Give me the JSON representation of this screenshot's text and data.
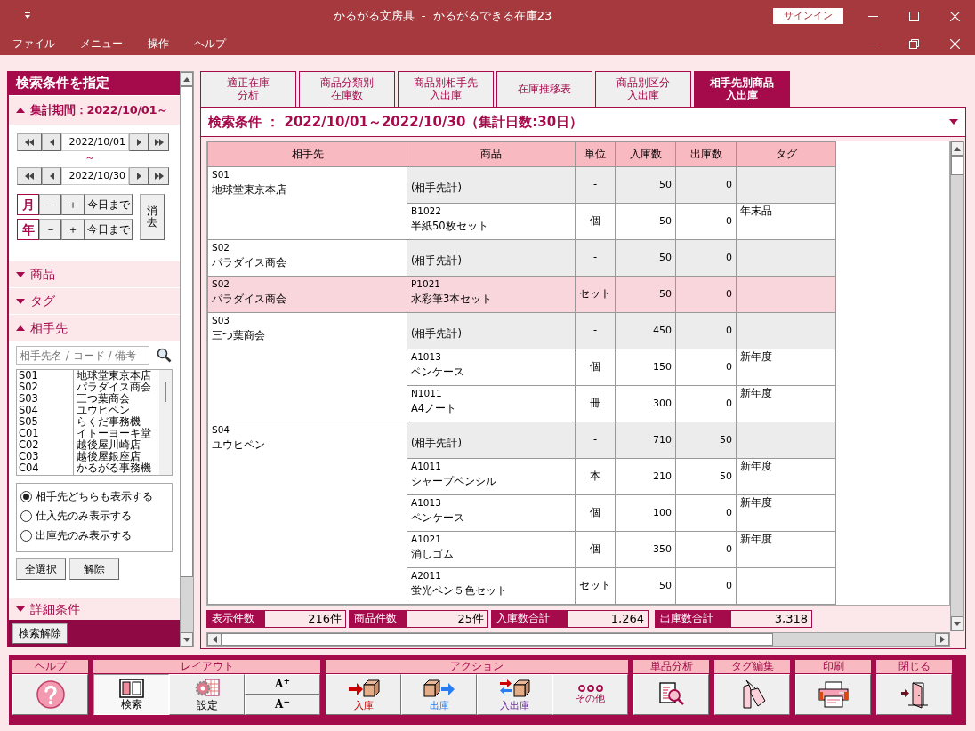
{
  "window": {
    "title": "かるがる文房具  -  かるがるできる在庫23",
    "sign_in": "サインイン"
  },
  "menu": [
    "ファイル",
    "メニュー",
    "操作",
    "ヘルプ"
  ],
  "sidebar": {
    "title": "検索条件を指定",
    "period": {
      "label": "集計期間：2022/10/01～",
      "expanded": true,
      "from": "2022/10/01",
      "separator": "～",
      "to": "2022/10/30",
      "steps": [
        {
          "unit": "月",
          "minus": "－",
          "plus": "＋",
          "today": "今日まで"
        },
        {
          "unit": "年",
          "minus": "－",
          "plus": "＋",
          "today": "今日まで"
        }
      ],
      "clear": "消去"
    },
    "sections": [
      {
        "label": "商品",
        "expanded": false
      },
      {
        "label": "タグ",
        "expanded": false
      }
    ],
    "partner": {
      "label": "相手先",
      "expanded": true,
      "placeholder": "相手先名 / コード / 備考",
      "list": [
        {
          "code": "S01",
          "name": "地球堂東京本店"
        },
        {
          "code": "S02",
          "name": "パラダイス商会"
        },
        {
          "code": "S03",
          "name": "三つ葉商会"
        },
        {
          "code": "S04",
          "name": "ユウヒペン"
        },
        {
          "code": "S05",
          "name": "らくだ事務機"
        },
        {
          "code": "C01",
          "name": "イトーヨーキ堂"
        },
        {
          "code": "C02",
          "name": "越後屋川崎店"
        },
        {
          "code": "C03",
          "name": "越後屋銀座店"
        },
        {
          "code": "C04",
          "name": "かるがる事務機"
        }
      ],
      "options": [
        {
          "label": "相手先どちらも表示する",
          "selected": true
        },
        {
          "label": "仕入先のみ表示する",
          "selected": false
        },
        {
          "label": "出庫先のみ表示する",
          "selected": false
        }
      ],
      "buttons": [
        "全選択",
        "解除"
      ]
    },
    "detail": {
      "label": "詳細条件",
      "expanded": false
    },
    "reset_button": "検索解除"
  },
  "tabs": [
    {
      "lines": [
        "適正在庫",
        "分析"
      ],
      "selected": false
    },
    {
      "lines": [
        "商品分類別",
        "在庫数"
      ],
      "selected": false
    },
    {
      "lines": [
        "商品別相手先",
        "入出庫"
      ],
      "selected": false
    },
    {
      "lines": [
        "在庫推移表"
      ],
      "selected": false
    },
    {
      "lines": [
        "商品別区分",
        "入出庫"
      ],
      "selected": false
    },
    {
      "lines": [
        "相手先別商品",
        "入出庫"
      ],
      "selected": true
    }
  ],
  "condition": "検索条件 ： 2022/10/01～2022/10/30（集計日数:30日）",
  "table": {
    "columns": [
      "相手先",
      "商品",
      "単位",
      "入庫数",
      "出庫数",
      "タグ"
    ],
    "groups": [
      {
        "code": "S01",
        "name": "地球堂東京本店",
        "selected": false,
        "rows": [
          {
            "kind": "subtotal",
            "product": "(相手先計)",
            "unit": "-",
            "in": "50",
            "out": "0"
          },
          {
            "kind": "item",
            "code": "B1022",
            "product": "半紙50枚セット",
            "unit": "個",
            "in": "50",
            "out": "0",
            "tag": "年末品"
          }
        ]
      },
      {
        "code": "S02",
        "name": "パラダイス商会",
        "selected": false,
        "rows": [
          {
            "kind": "subtotal",
            "product": "(相手先計)",
            "unit": "-",
            "in": "50",
            "out": "0"
          }
        ]
      },
      {
        "code": "S02",
        "name": "パラダイス商会",
        "selected": true,
        "rows": [
          {
            "kind": "item",
            "code": "P1021",
            "product": "水彩筆3本セット",
            "unit": "セット",
            "in": "50",
            "out": "0"
          }
        ]
      },
      {
        "code": "S03",
        "name": "三つ葉商会",
        "selected": false,
        "rows": [
          {
            "kind": "subtotal",
            "product": "(相手先計)",
            "unit": "-",
            "in": "450",
            "out": "0"
          },
          {
            "kind": "item",
            "code": "A1013",
            "product": "ペンケース",
            "unit": "個",
            "in": "150",
            "out": "0",
            "tag": "新年度"
          },
          {
            "kind": "item",
            "code": "N1011",
            "product": "A4ノート",
            "unit": "冊",
            "in": "300",
            "out": "0",
            "tag": "新年度"
          }
        ]
      },
      {
        "code": "S04",
        "name": "ユウヒペン",
        "selected": false,
        "rows": [
          {
            "kind": "subtotal",
            "product": "(相手先計)",
            "unit": "-",
            "in": "710",
            "out": "50"
          },
          {
            "kind": "item",
            "code": "A1011",
            "product": "シャープペンシル",
            "unit": "本",
            "in": "210",
            "out": "50",
            "tag": "新年度"
          },
          {
            "kind": "item",
            "code": "A1013",
            "product": "ペンケース",
            "unit": "個",
            "in": "100",
            "out": "0",
            "tag": "新年度"
          },
          {
            "kind": "item",
            "code": "A1021",
            "product": "消しゴム",
            "unit": "個",
            "in": "350",
            "out": "0",
            "tag": "新年度"
          },
          {
            "kind": "item",
            "code": "A2011",
            "product": "蛍光ペン５色セット",
            "unit": "セット",
            "in": "50",
            "out": "0"
          }
        ]
      }
    ]
  },
  "summary": [
    {
      "label": "表示件数",
      "value": "216件"
    },
    {
      "label": "商品件数",
      "value": "25件"
    },
    {
      "label": "入庫数合計",
      "value": "1,264"
    },
    {
      "label": "出庫数合計",
      "value": "3,318"
    }
  ],
  "toolbar": [
    {
      "label": "ヘルプ",
      "buttons": [
        {
          "kind": "help"
        }
      ]
    },
    {
      "label": "レイアウト",
      "buttons": [
        {
          "kind": "search",
          "label": "検索",
          "selected": true
        },
        {
          "kind": "settings",
          "label": "設定",
          "selected": false
        },
        {
          "kind": "font_size",
          "up": "A$^{+}$",
          "down": "A$^{−}$"
        }
      ]
    },
    {
      "label": "アクション",
      "buttons": [
        {
          "kind": "in",
          "label": "入庫"
        },
        {
          "kind": "out",
          "label": "出庫"
        },
        {
          "kind": "inout",
          "label": "入出庫"
        },
        {
          "kind": "other",
          "label": "その他"
        }
      ]
    },
    {
      "label": "単品分析",
      "buttons": [
        {
          "kind": "analysis"
        }
      ]
    },
    {
      "label": "タグ編集",
      "buttons": [
        {
          "kind": "tags"
        }
      ]
    },
    {
      "label": "印刷",
      "buttons": [
        {
          "kind": "print"
        }
      ]
    },
    {
      "label": "閉じる",
      "buttons": [
        {
          "kind": "close"
        }
      ]
    }
  ]
}
